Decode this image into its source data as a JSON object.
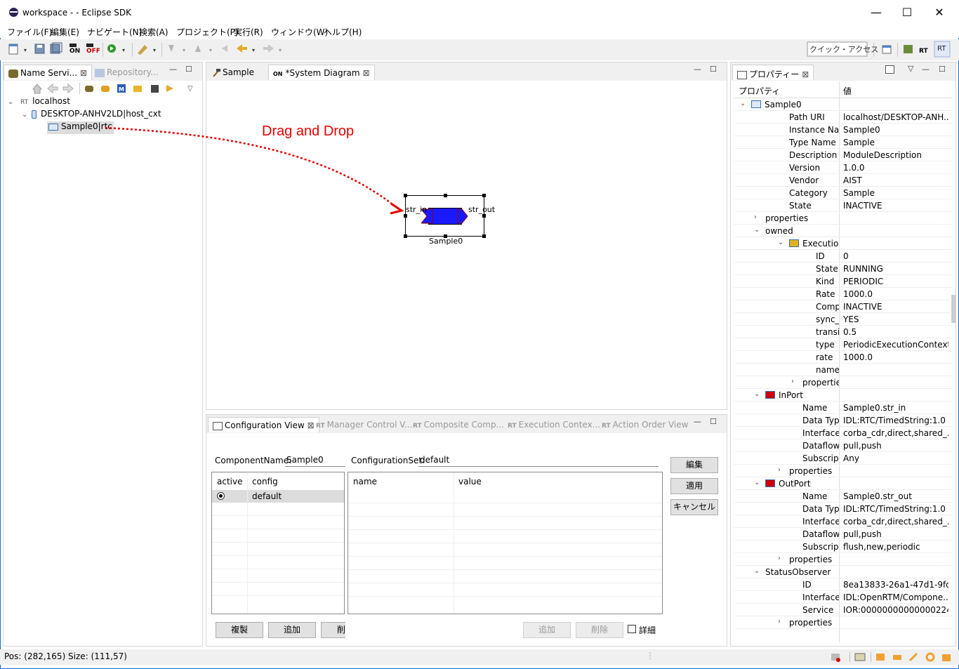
{
  "window": {
    "title": "workspace -  - Eclipse SDK"
  },
  "menu": [
    "ファイル(F)",
    "編集(E)",
    "ナビゲート(N)",
    "検索(A)",
    "プロジェクト(P)",
    "実行(R)",
    "ウィンドウ(W)",
    "ヘルプ(H)"
  ],
  "toolbar": {
    "quick_access": "クイック・アクセス",
    "perspective_label": "RT"
  },
  "left_panel": {
    "tabs": [
      "Name Servi...",
      "Repository..."
    ],
    "tree": {
      "root": "localhost",
      "host": "DESKTOP-ANHV2LD|host_cxt",
      "component": "Sample0|rtc"
    }
  },
  "editor": {
    "tabs": [
      "Sample",
      "*System Diagram"
    ],
    "annotation": "Drag and Drop",
    "component": {
      "name": "Sample0",
      "in_port": "str_in",
      "out_port": "str_out"
    }
  },
  "bottom": {
    "tabs": [
      "Configuration View",
      "Manager Control V...",
      "Composite Comp...",
      "Execution Contex...",
      "Action Order View"
    ],
    "component_name_label": "ComponentName:",
    "component_name_value": "Sample0",
    "config_set_label": "ConfigurationSet:",
    "config_set_value": "default",
    "left_grid_headers": [
      "active",
      "config"
    ],
    "left_grid_row": "default",
    "right_grid_headers": [
      "name",
      "value"
    ],
    "side_buttons": [
      "編集",
      "適用",
      "キャンセル"
    ],
    "bottom_buttons": [
      "複製",
      "追加",
      "削"
    ],
    "right_buttons": [
      "追加",
      "削除"
    ],
    "detail_label": "詳細"
  },
  "properties": {
    "title": "プロパティー",
    "header_prop": "プロパティ",
    "header_val": "値",
    "rows": [
      {
        "i": 0,
        "tw": "down",
        "icon": "comp",
        "k": "Sample0",
        "v": ""
      },
      {
        "i": 2,
        "k": "Path URI",
        "v": "localhost/DESKTOP-ANH..."
      },
      {
        "i": 2,
        "k": "Instance Name",
        "v": "Sample0"
      },
      {
        "i": 2,
        "k": "Type Name",
        "v": "Sample"
      },
      {
        "i": 2,
        "k": "Description",
        "v": "ModuleDescription"
      },
      {
        "i": 2,
        "k": "Version",
        "v": "1.0.0"
      },
      {
        "i": 2,
        "k": "Vendor",
        "v": "AIST"
      },
      {
        "i": 2,
        "k": "Category",
        "v": "Sample"
      },
      {
        "i": 2,
        "k": "State",
        "v": "INACTIVE"
      },
      {
        "i": 1,
        "tw": "right",
        "k": "properties",
        "v": ""
      },
      {
        "i": 1,
        "tw": "down",
        "k": "owned",
        "v": ""
      },
      {
        "i": 2,
        "tw": "down",
        "icon": "ec",
        "k": "ExecutionCor",
        "v": ""
      },
      {
        "i": 4,
        "k": "ID",
        "v": "0"
      },
      {
        "i": 4,
        "k": "State",
        "v": "RUNNING"
      },
      {
        "i": 4,
        "k": "Kind",
        "v": "PERIODIC"
      },
      {
        "i": 4,
        "k": "Rate",
        "v": "1000.0"
      },
      {
        "i": 4,
        "k": "Compone",
        "v": "INACTIVE"
      },
      {
        "i": 4,
        "k": "sync_tran",
        "v": "YES"
      },
      {
        "i": 4,
        "k": "transition",
        "v": "0.5"
      },
      {
        "i": 4,
        "k": "type",
        "v": "PeriodicExecutionContext"
      },
      {
        "i": 4,
        "k": "rate",
        "v": "1000.0"
      },
      {
        "i": 4,
        "k": "name",
        "v": ""
      },
      {
        "i": 3,
        "tw": "right",
        "k": "propertie",
        "v": ""
      },
      {
        "i": 1,
        "tw": "down",
        "icon": "in",
        "k": "InPort",
        "v": ""
      },
      {
        "i": 3,
        "k": "Name",
        "v": "Sample0.str_in"
      },
      {
        "i": 3,
        "k": "Data Type",
        "v": "IDL:RTC/TimedString:1.0"
      },
      {
        "i": 3,
        "k": "Interface Typ",
        "v": "corba_cdr,direct,shared_..."
      },
      {
        "i": 3,
        "k": "Dataflow Typ",
        "v": "pull,push"
      },
      {
        "i": 3,
        "k": "Subscription",
        "v": "Any"
      },
      {
        "i": 2,
        "tw": "right",
        "k": "properties",
        "v": ""
      },
      {
        "i": 1,
        "tw": "down",
        "icon": "out",
        "k": "OutPort",
        "v": ""
      },
      {
        "i": 3,
        "k": "Name",
        "v": "Sample0.str_out"
      },
      {
        "i": 3,
        "k": "Data Type",
        "v": "IDL:RTC/TimedString:1.0"
      },
      {
        "i": 3,
        "k": "Interface Typ",
        "v": "corba_cdr,direct,shared_..."
      },
      {
        "i": 3,
        "k": "Dataflow Typ",
        "v": "pull,push"
      },
      {
        "i": 3,
        "k": "Subscription",
        "v": "flush,new,periodic"
      },
      {
        "i": 2,
        "tw": "right",
        "k": "properties",
        "v": ""
      },
      {
        "i": 1,
        "tw": "down",
        "k": "StatusObserver",
        "v": ""
      },
      {
        "i": 3,
        "k": "ID",
        "v": "8ea13833-26a1-47d1-9fd..."
      },
      {
        "i": 3,
        "k": "Interface Typ",
        "v": "IDL:OpenRTM/Compone..."
      },
      {
        "i": 3,
        "k": "Service",
        "v": "IOR:000000000000002249..."
      },
      {
        "i": 2,
        "tw": "right",
        "k": "properties",
        "v": ""
      }
    ]
  },
  "status": {
    "text": "Pos: (282,165) Size: (111,57)"
  }
}
